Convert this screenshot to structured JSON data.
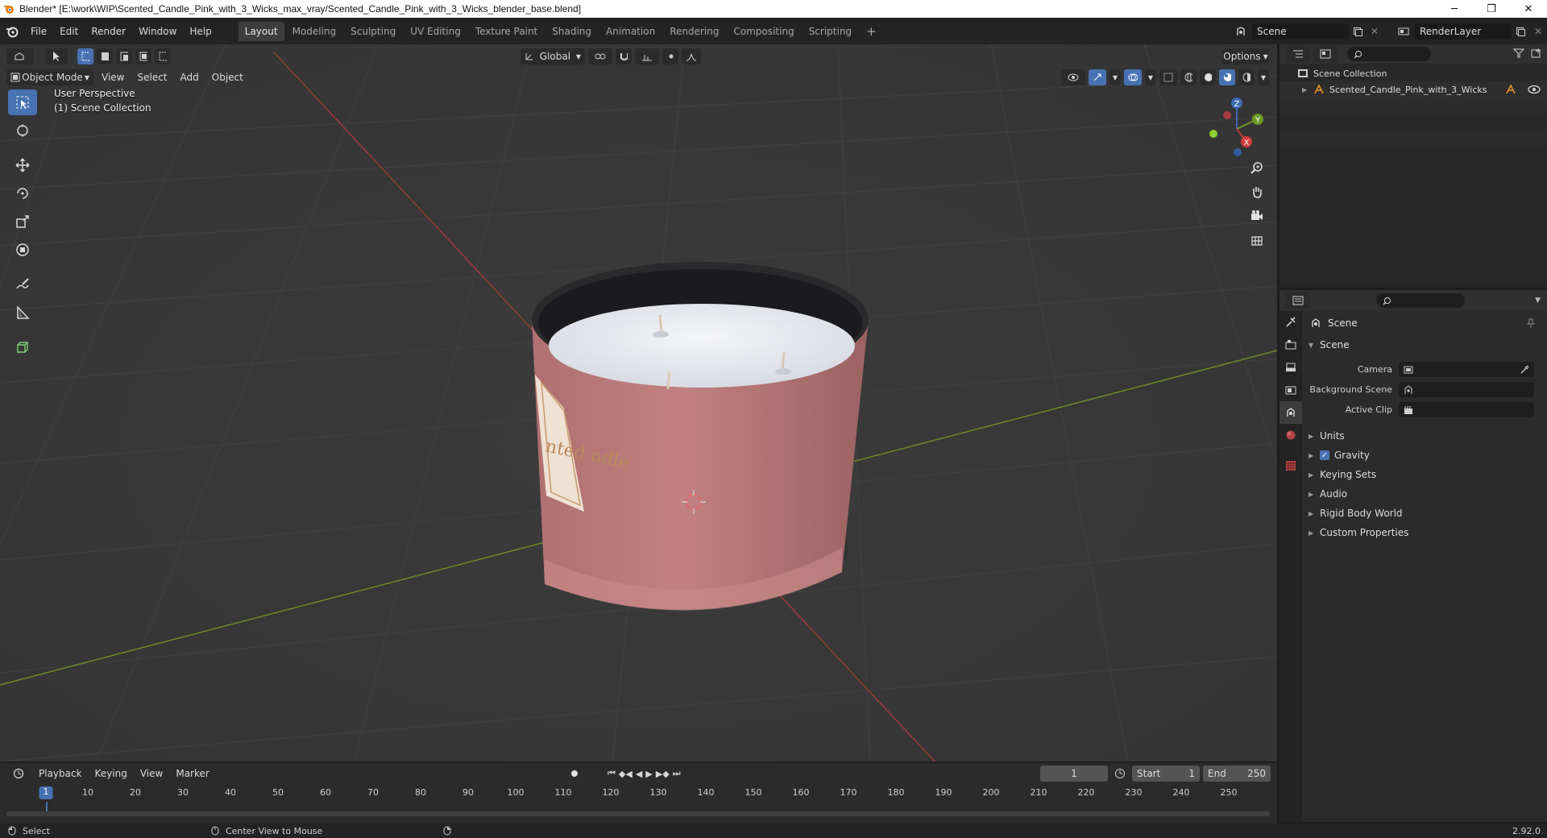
{
  "window": {
    "title": "Blender* [E:\\work\\WIP\\Scented_Candle_Pink_with_3_Wicks_max_vray/Scented_Candle_Pink_with_3_Wicks_blender_base.blend]",
    "minimize": "─",
    "maximize": "❐",
    "close": "✕"
  },
  "menubar": {
    "items": [
      "File",
      "Edit",
      "Render",
      "Window",
      "Help"
    ],
    "workspaces": [
      "Layout",
      "Modeling",
      "Sculpting",
      "UV Editing",
      "Texture Paint",
      "Shading",
      "Animation",
      "Rendering",
      "Compositing",
      "Scripting"
    ],
    "add_tab": "+",
    "scene_name": "Scene",
    "view_layer": "RenderLayer"
  },
  "viewport": {
    "mode": "Object Mode",
    "menus": [
      "View",
      "Select",
      "Add",
      "Object"
    ],
    "transform_orientation": "Global",
    "options_label": "Options",
    "overlay_line1": "User Perspective",
    "overlay_line2": "(1) Scene Collection",
    "gizmo_axes": {
      "x": "X",
      "y": "Y",
      "z": "Z"
    },
    "colors": {
      "x_axis": "#9b3b3b",
      "y_axis": "#6f8a2a",
      "accent": "#4772b3"
    }
  },
  "outliner": {
    "root": "Scene Collection",
    "child": "Scented_Candle_Pink_with_3_Wicks"
  },
  "properties": {
    "context": "Scene",
    "panel": "Scene",
    "fields": [
      {
        "label": "Camera"
      },
      {
        "label": "Background Scene"
      },
      {
        "label": "Active Clip"
      }
    ],
    "subpanels": [
      "Units",
      "Gravity",
      "Keying Sets",
      "Audio",
      "Rigid Body World",
      "Custom Properties"
    ],
    "gravity_checked": true
  },
  "timeline": {
    "menus": [
      "Playback",
      "Keying",
      "View",
      "Marker"
    ],
    "current_frame": "1",
    "start_label": "Start",
    "start_value": "1",
    "end_label": "End",
    "end_value": "250",
    "ticks": [
      "10",
      "20",
      "30",
      "40",
      "50",
      "60",
      "70",
      "80",
      "90",
      "100",
      "110",
      "120",
      "130",
      "140",
      "150",
      "160",
      "170",
      "180",
      "190",
      "200",
      "210",
      "220",
      "230",
      "240",
      "250"
    ],
    "cursor_frame": "1"
  },
  "statusbar": {
    "left": "Select",
    "middle": "Center View to Mouse",
    "version": "2.92.0"
  },
  "candle_label_text": "nted ndle"
}
